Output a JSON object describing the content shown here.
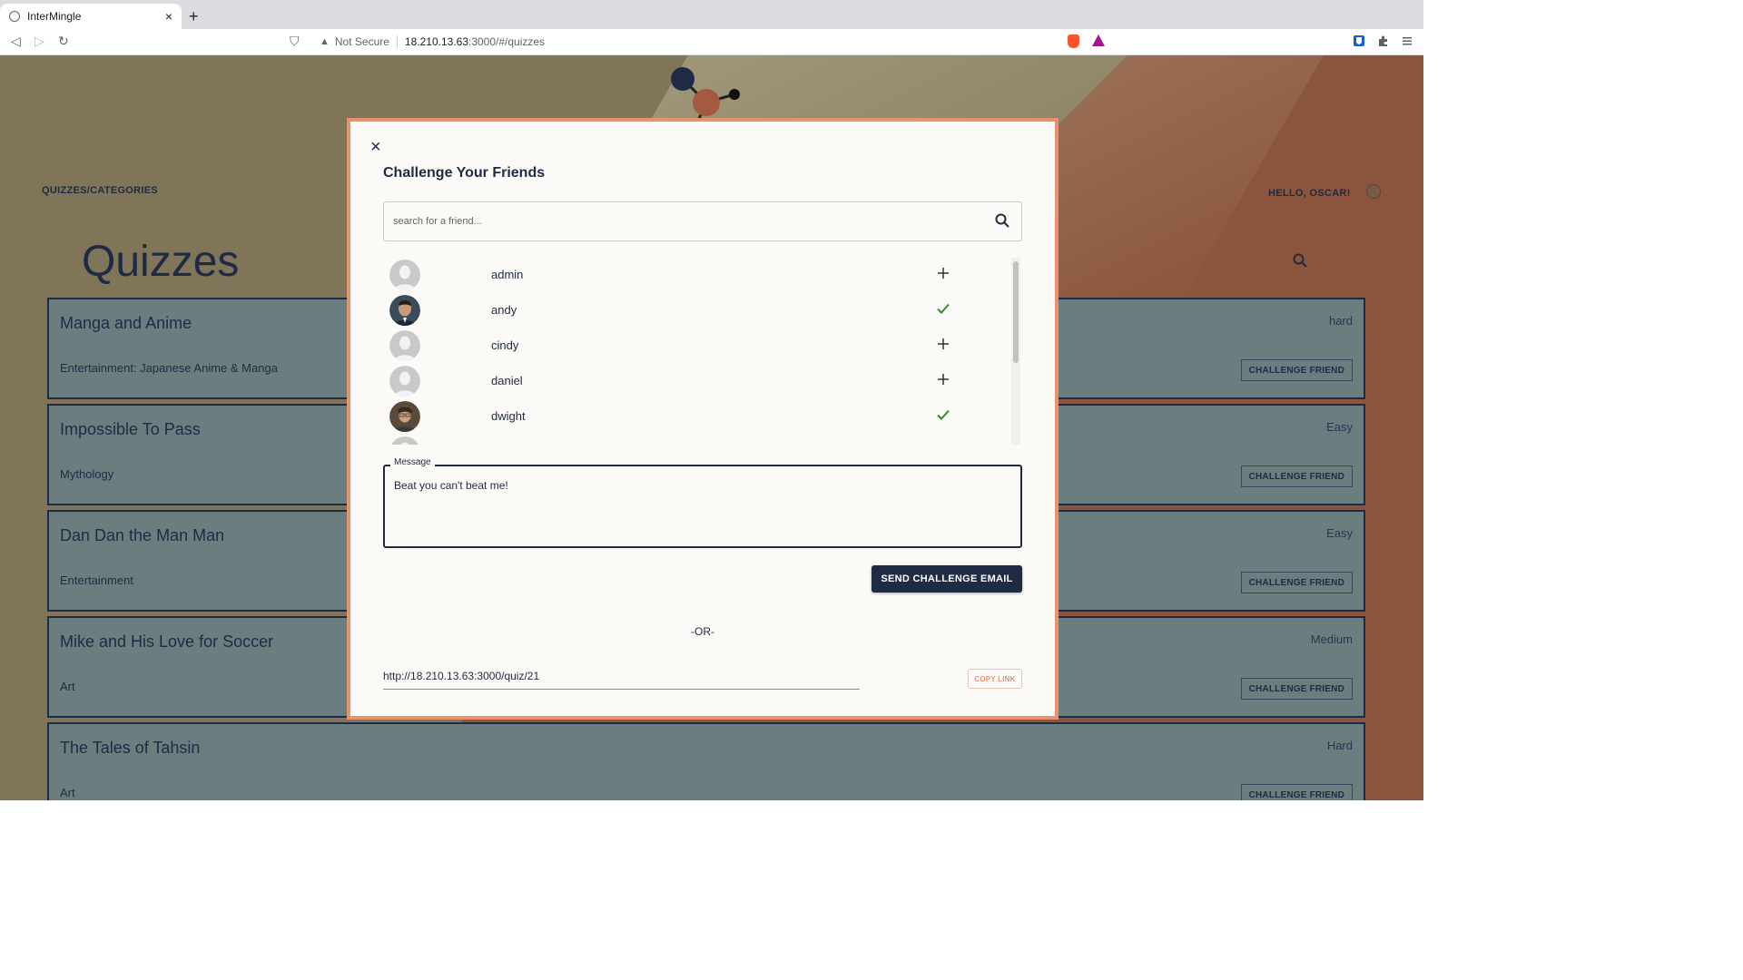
{
  "browser": {
    "tab_title": "InterMingle",
    "tab_close": "×",
    "new_tab": "+",
    "not_secure": "Not Secure",
    "url_host": "18.210.13.63",
    "url_path": ":3000/#/quizzes"
  },
  "header": {
    "breadcrumb": "QUIZZES/CATEGORIES",
    "greeting": "HELLO, OSCAR!",
    "page_title": "Quizzes"
  },
  "quizzes": [
    {
      "name": "Manga and Anime",
      "category": "Entertainment: Japanese Anime & Manga",
      "difficulty": "hard",
      "button": "CHALLENGE FRIEND"
    },
    {
      "name": "Impossible To Pass",
      "category": "Mythology",
      "difficulty": "Easy",
      "button": "CHALLENGE FRIEND"
    },
    {
      "name": "Dan Dan the Man Man",
      "category": "Entertainment",
      "difficulty": "Easy",
      "button": "CHALLENGE FRIEND"
    },
    {
      "name": "Mike and His Love for Soccer",
      "category": "Art",
      "difficulty": "Medium",
      "button": "CHALLENGE FRIEND"
    },
    {
      "name": "The Tales of Tahsin",
      "category": "Art",
      "difficulty": "Hard",
      "button": "CHALLENGE FRIEND"
    }
  ],
  "modal": {
    "close": "×",
    "title": "Challenge Your Friends",
    "search_placeholder": "search for a friend...",
    "friends": [
      {
        "name": "admin",
        "avatar": "default",
        "selected": false
      },
      {
        "name": "andy",
        "avatar": "photo",
        "selected": true
      },
      {
        "name": "cindy",
        "avatar": "default",
        "selected": false
      },
      {
        "name": "daniel",
        "avatar": "default",
        "selected": false
      },
      {
        "name": "dwight",
        "avatar": "photo",
        "selected": true
      }
    ],
    "message_label": "Message",
    "message_value": "Beat you can't beat me!",
    "send_button": "SEND CHALLENGE EMAIL",
    "or_text": "-OR-",
    "link_value": "http://18.210.13.63:3000/quiz/21",
    "copy_button": "COPY LINK"
  },
  "colors": {
    "navy": "#1f2a44",
    "accent": "#e8936e",
    "check": "#2e8b3a"
  }
}
